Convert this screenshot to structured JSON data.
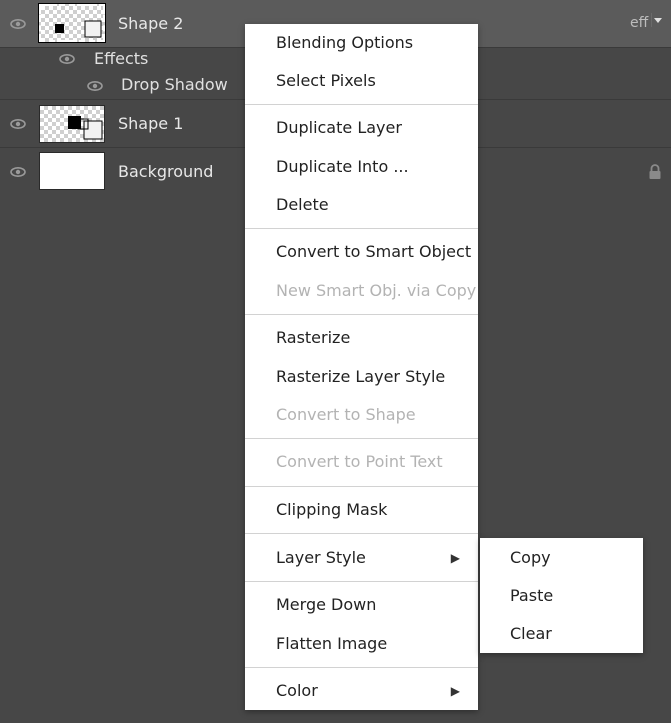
{
  "layers": [
    {
      "name": "Shape 2",
      "selected": true,
      "tag": "eff"
    },
    {
      "name": "Shape 1"
    },
    {
      "name": "Background"
    }
  ],
  "effects": {
    "label": "Effects",
    "items": [
      "Drop Shadow"
    ]
  },
  "icons": {
    "visibility": "eye-icon",
    "lock": "lock-icon",
    "submenu": "triangle-right-icon",
    "dropdown": "chevron-down-icon"
  },
  "context_menu": {
    "items": [
      {
        "label": "Blending Options"
      },
      {
        "label": "Select Pixels"
      },
      {
        "label": "Duplicate Layer"
      },
      {
        "label": "Duplicate Into ..."
      },
      {
        "label": "Delete"
      },
      {
        "label": "Convert to Smart Object"
      },
      {
        "label": "New Smart Obj. via Copy",
        "disabled": true
      },
      {
        "label": "Rasterize"
      },
      {
        "label": "Rasterize Layer Style"
      },
      {
        "label": "Convert to Shape",
        "disabled": true
      },
      {
        "label": "Convert to Point Text",
        "disabled": true
      },
      {
        "label": "Clipping Mask"
      },
      {
        "label": "Layer Style",
        "submenu": true
      },
      {
        "label": "Merge Down"
      },
      {
        "label": "Flatten Image"
      },
      {
        "label": "Color",
        "submenu": true
      }
    ]
  },
  "submenu": {
    "items": [
      "Copy",
      "Paste",
      "Clear"
    ]
  },
  "colors": {
    "panel_bg": "#474747",
    "selected_row": "#5b5b5b",
    "menu_bg": "#ffffff",
    "disabled_text": "#b3b3b3"
  }
}
